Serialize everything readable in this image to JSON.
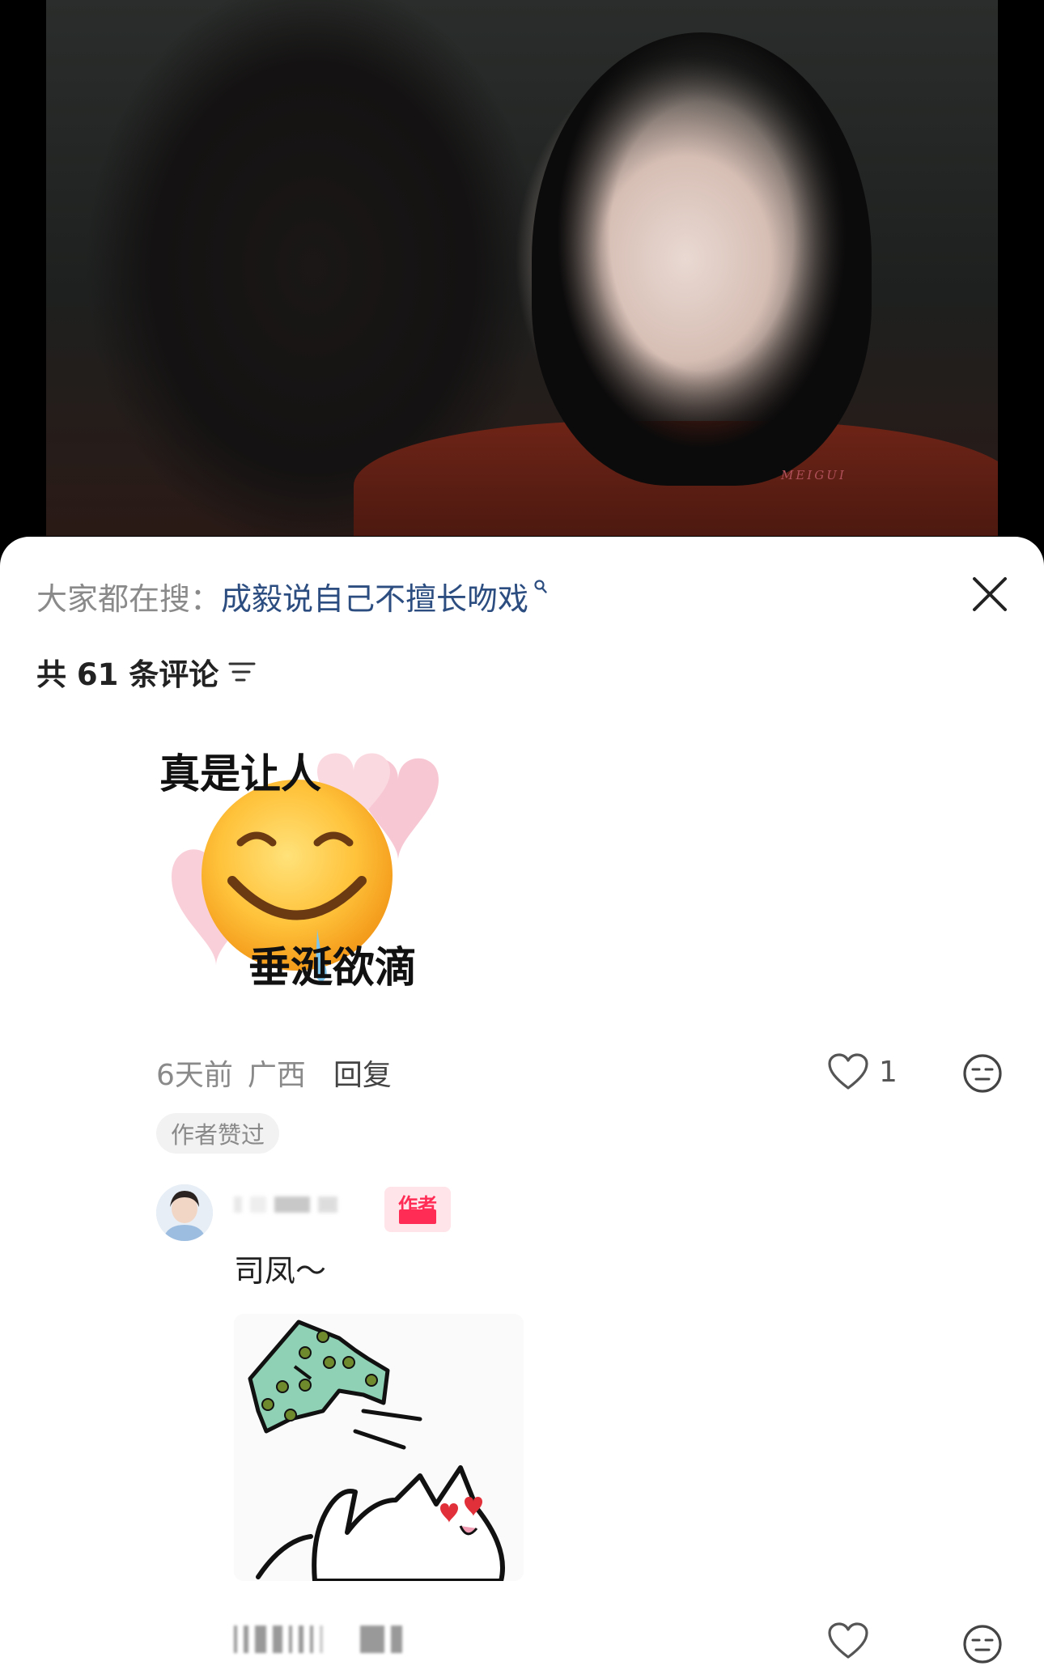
{
  "video": {
    "watermark": "MEIGUI"
  },
  "search": {
    "prefix": "大家都在搜：",
    "term": "成毅说自己不擅长吻戏",
    "icon": "search-icon"
  },
  "comments_header": {
    "label": "共 61 条评论"
  },
  "comment": {
    "sticker_text_top": "真是让人",
    "sticker_text_bottom": "垂涎欲滴",
    "time": "6天前",
    "location": "广西",
    "reply_label": "回复",
    "like_count": "1",
    "badge": "作者赞过"
  },
  "reply": {
    "author_tag": "作者",
    "text": "司凤～"
  },
  "colors": {
    "link": "#2c4d80",
    "author_tag": "#ff2d55",
    "muted": "#8a8a8a"
  }
}
